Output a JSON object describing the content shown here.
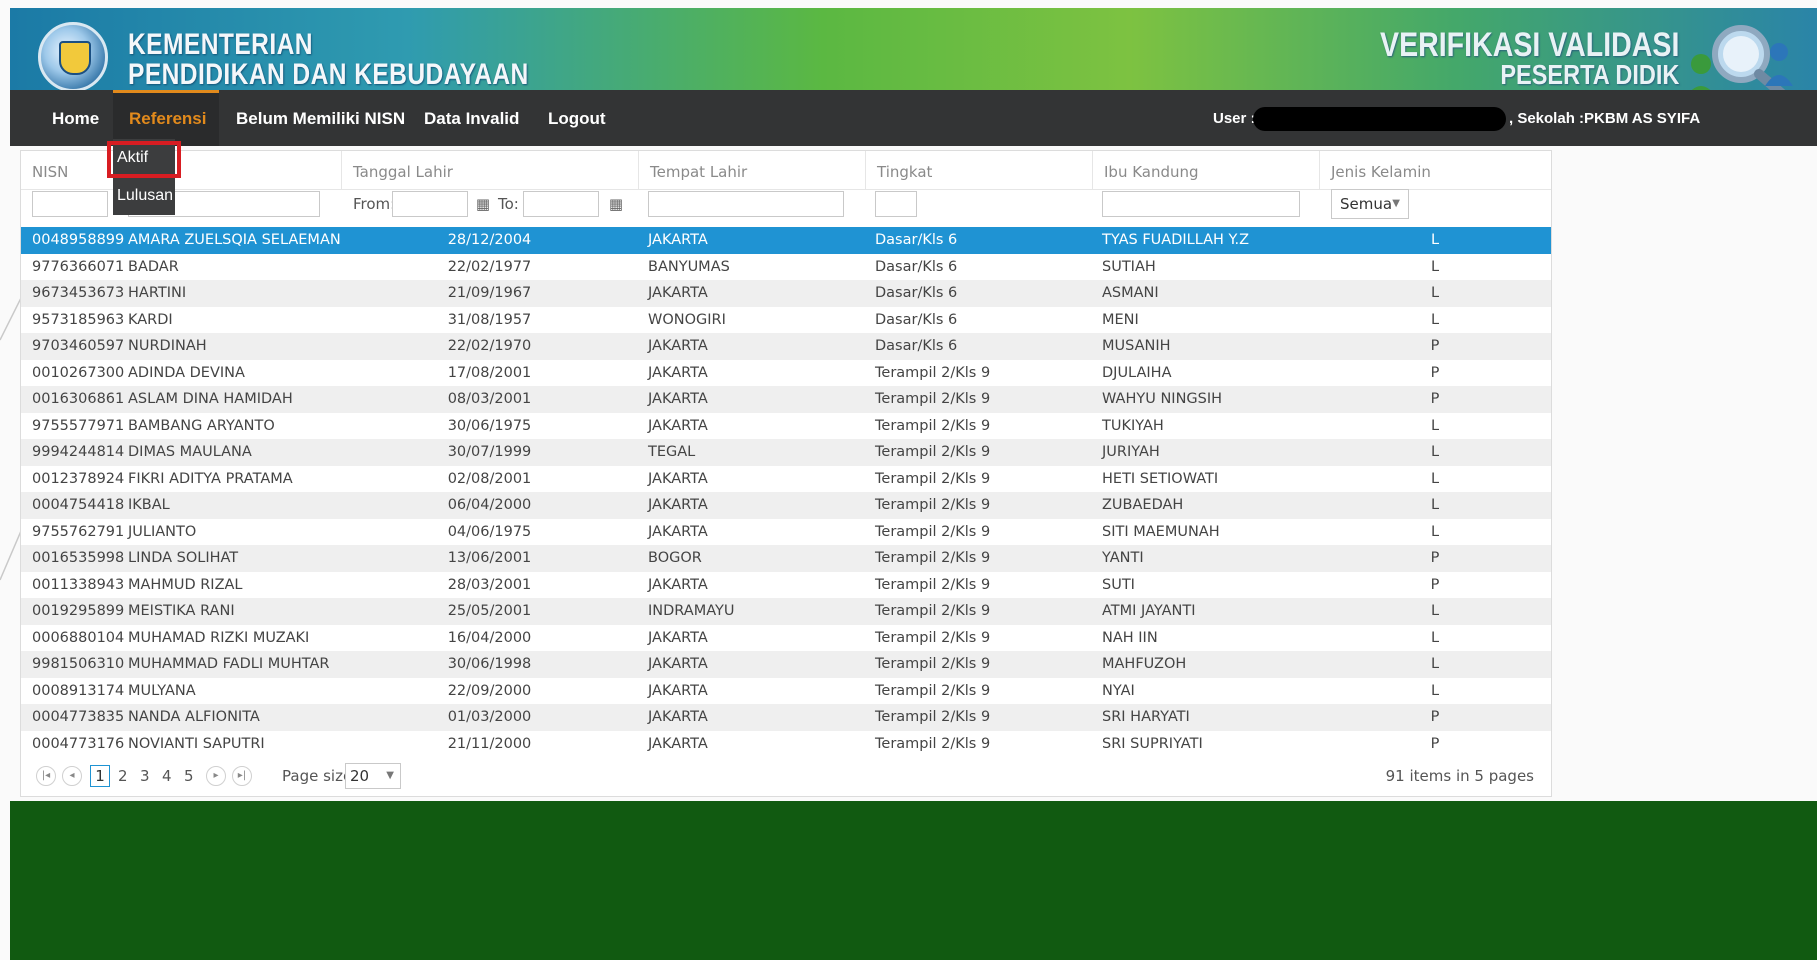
{
  "header": {
    "ministry_line1": "KEMENTERIAN",
    "ministry_line2": "PENDIDIKAN DAN KEBUDAYAAN",
    "app_line1": "VERIFIKASI VALIDASI",
    "app_line2": "PESERTA DIDIK"
  },
  "nav": {
    "items": [
      "Home",
      "Referensi",
      "Belum Memiliki NISN",
      "Data Invalid",
      "Logout"
    ],
    "active": "Referensi",
    "user_label": "User :",
    "school_label": ", Sekolah :PKBM AS SYIFA"
  },
  "dropdown": {
    "items": [
      "Aktif",
      "Lulusan"
    ],
    "highlighted": "Aktif"
  },
  "grid": {
    "columns": [
      "NISN",
      "",
      "Tanggal Lahir",
      "Tempat Lahir",
      "Tingkat",
      "Ibu Kandung",
      "Jenis Kelamin"
    ],
    "filter_from_label": "From:",
    "filter_to_label": "To:",
    "gender_filter": "Semua",
    "selected_row_index": 0,
    "rows": [
      [
        "0048958899",
        "AMARA ZUELSQIA SELAEMAN",
        "28/12/2004",
        "JAKARTA",
        "Dasar/Kls 6",
        "TYAS FUADILLAH Y.Z",
        "L"
      ],
      [
        "9776366071",
        "BADAR",
        "22/02/1977",
        "BANYUMAS",
        "Dasar/Kls 6",
        "SUTIAH",
        "L"
      ],
      [
        "9673453673",
        "HARTINI",
        "21/09/1967",
        "JAKARTA",
        "Dasar/Kls 6",
        "ASMANI",
        "L"
      ],
      [
        "9573185963",
        "KARDI",
        "31/08/1957",
        "WONOGIRI",
        "Dasar/Kls 6",
        "MENI",
        "L"
      ],
      [
        "9703460597",
        "NURDINAH",
        "22/02/1970",
        "JAKARTA",
        "Dasar/Kls 6",
        "MUSANIH",
        "P"
      ],
      [
        "0010267300",
        "ADINDA DEVINA",
        "17/08/2001",
        "JAKARTA",
        "Terampil 2/Kls 9",
        "DJULAIHA",
        "P"
      ],
      [
        "0016306861",
        "ASLAM DINA HAMIDAH",
        "08/03/2001",
        "JAKARTA",
        "Terampil 2/Kls 9",
        "WAHYU NINGSIH",
        "P"
      ],
      [
        "9755577971",
        "BAMBANG ARYANTO",
        "30/06/1975",
        "JAKARTA",
        "Terampil 2/Kls 9",
        "TUKIYAH",
        "L"
      ],
      [
        "9994244814",
        "DIMAS MAULANA",
        "30/07/1999",
        "TEGAL",
        "Terampil 2/Kls 9",
        "JURIYAH",
        "L"
      ],
      [
        "0012378924",
        "FIKRI ADITYA PRATAMA",
        "02/08/2001",
        "JAKARTA",
        "Terampil 2/Kls 9",
        "HETI SETIOWATI",
        "L"
      ],
      [
        "0004754418",
        "IKBAL",
        "06/04/2000",
        "JAKARTA",
        "Terampil 2/Kls 9",
        "ZUBAEDAH",
        "L"
      ],
      [
        "9755762791",
        "JULIANTO",
        "04/06/1975",
        "JAKARTA",
        "Terampil 2/Kls 9",
        "SITI MAEMUNAH",
        "L"
      ],
      [
        "0016535998",
        "LINDA SOLIHAT",
        "13/06/2001",
        "BOGOR",
        "Terampil 2/Kls 9",
        "YANTI",
        "P"
      ],
      [
        "0011338943",
        "MAHMUD RIZAL",
        "28/03/2001",
        "JAKARTA",
        "Terampil 2/Kls 9",
        "SUTI",
        "P"
      ],
      [
        "0019295899",
        "MEISTIKA RANI",
        "25/05/2001",
        "INDRAMAYU",
        "Terampil 2/Kls 9",
        "ATMI JAYANTI",
        "L"
      ],
      [
        "0006880104",
        "MUHAMAD RIZKI MUZAKI",
        "16/04/2000",
        "JAKARTA",
        "Terampil 2/Kls 9",
        "NAH IIN",
        "L"
      ],
      [
        "9981506310",
        "MUHAMMAD FADLI MUHTAR",
        "30/06/1998",
        "JAKARTA",
        "Terampil 2/Kls 9",
        "MAHFUZOH",
        "L"
      ],
      [
        "0008913174",
        "MULYANA",
        "22/09/2000",
        "JAKARTA",
        "Terampil 2/Kls 9",
        "NYAI",
        "L"
      ],
      [
        "0004773835",
        "NANDA ALFIONITA",
        "01/03/2000",
        "JAKARTA",
        "Terampil 2/Kls 9",
        "SRI HARYATI",
        "P"
      ],
      [
        "0004773176",
        "NOVIANTI SAPUTRI",
        "21/11/2000",
        "JAKARTA",
        "Terampil 2/Kls 9",
        "SRI SUPRIYATI",
        "P"
      ]
    ]
  },
  "pager": {
    "first_icon": "first-page-icon",
    "prev_icon": "prev-page-icon",
    "next_icon": "next-page-icon",
    "last_icon": "last-page-icon",
    "pages": [
      "1",
      "2",
      "3",
      "4",
      "5"
    ],
    "current_page": "1",
    "page_size_label": "Page size:",
    "page_size": "20",
    "summary": "91 items in 5 pages"
  },
  "colors": {
    "nav_bg": "#333435",
    "active_tab": "#e28a1c",
    "selected_row": "#1f93d3",
    "footer": "#115a11",
    "highlight_box": "#d81d22"
  }
}
